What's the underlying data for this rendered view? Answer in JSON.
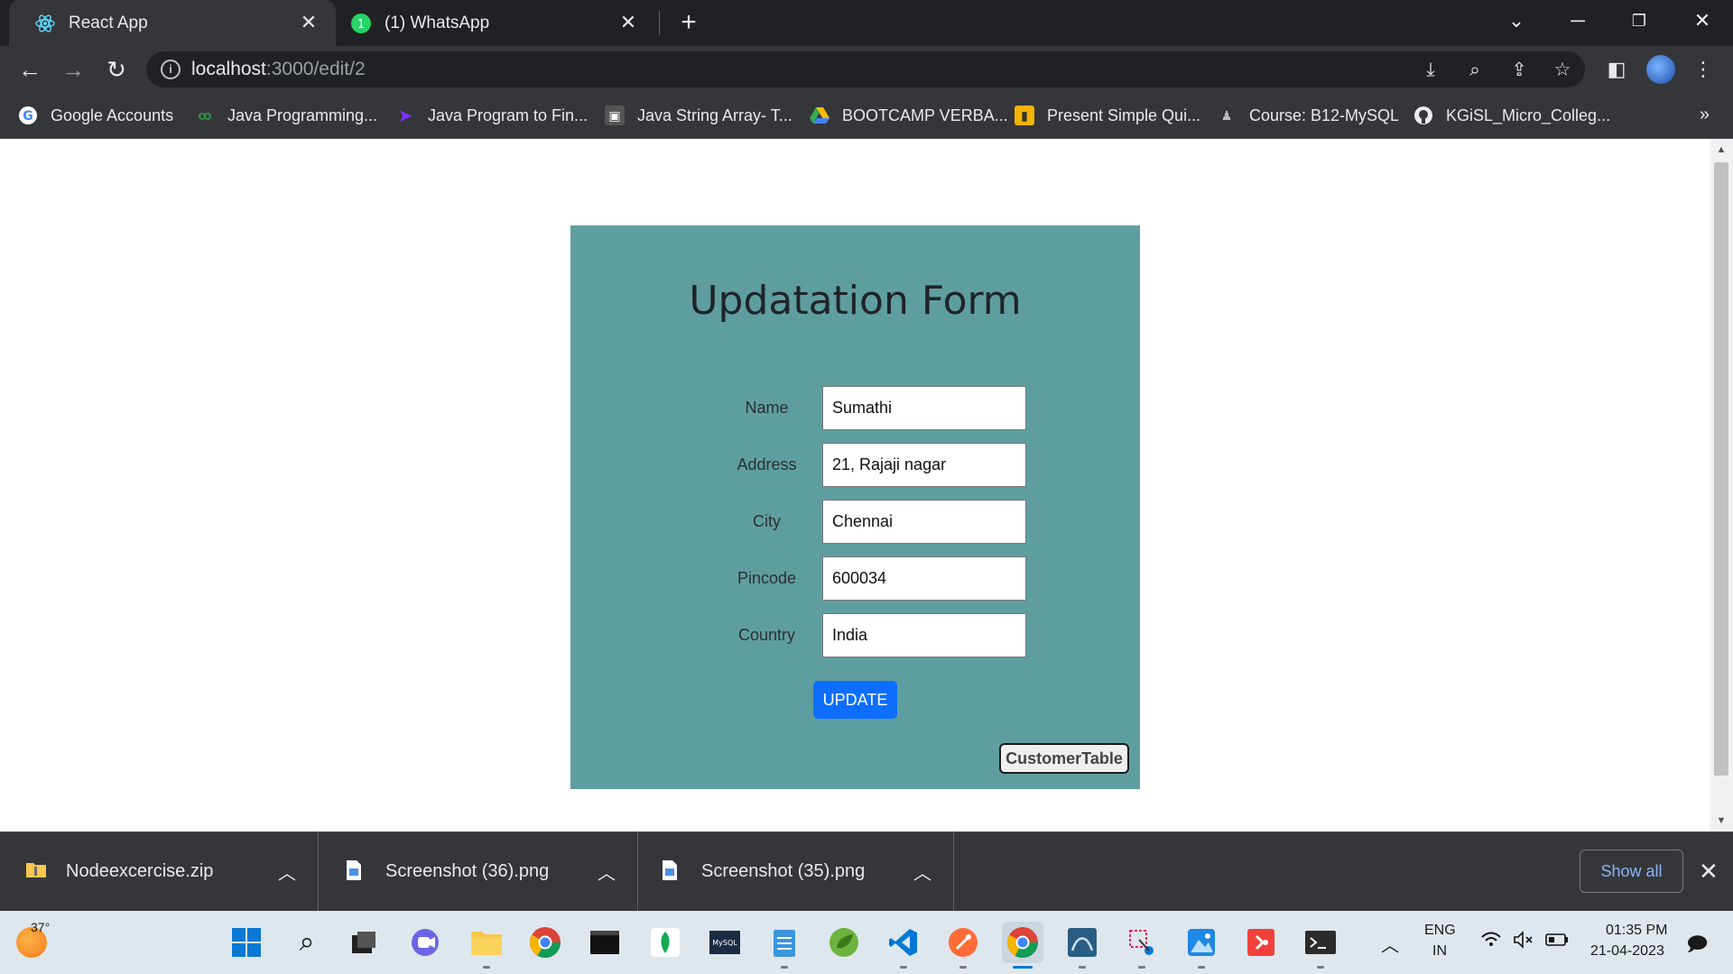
{
  "browser": {
    "tabs": [
      {
        "title": "React App",
        "active": true,
        "icon": "react-icon"
      },
      {
        "title": "(1) WhatsApp",
        "active": false,
        "icon": "whatsapp-icon"
      }
    ],
    "url_host": "localhost",
    "url_path": ":3000/edit/2",
    "bookmarks": [
      {
        "label": "Google Accounts",
        "icon": "google-icon",
        "color": "#4285f4"
      },
      {
        "label": "Java Programming...",
        "icon": "gfg-icon",
        "color": "#2f8d46"
      },
      {
        "label": "Java Program to Fin...",
        "icon": "bookmark-icon",
        "color": "#7b2ff7"
      },
      {
        "label": "Java String Array- T...",
        "icon": "bookmark-icon",
        "color": "#555555"
      },
      {
        "label": "BOOTCAMP VERBA...",
        "icon": "drive-icon",
        "color": "#fbbc04"
      },
      {
        "label": "Present Simple Qui...",
        "icon": "bookmark-icon",
        "color": "#f4b400"
      },
      {
        "label": "Course: B12-MySQL",
        "icon": "bookmark-icon",
        "color": "#9e9e9e"
      },
      {
        "label": "KGiSL_Micro_Colleg...",
        "icon": "github-icon",
        "color": "#e8eaed"
      }
    ]
  },
  "form": {
    "title": "Updatation Form",
    "fields": [
      {
        "label": "Name",
        "value": "Sumathi"
      },
      {
        "label": "Address",
        "value": "21, Rajaji nagar"
      },
      {
        "label": "City",
        "value": "Chennai"
      },
      {
        "label": "Pincode",
        "value": "600034"
      },
      {
        "label": "Country",
        "value": "India"
      }
    ],
    "update_label": "UPDATE",
    "customer_table_label": "CustomerTable",
    "background": "#5f9ea0",
    "button_color": "#0d6efd"
  },
  "downloads": {
    "items": [
      {
        "name": "Nodeexcercise.zip",
        "icon": "zip-folder-icon"
      },
      {
        "name": "Screenshot (36).png",
        "icon": "image-file-icon"
      },
      {
        "name": "Screenshot (35).png",
        "icon": "image-file-icon"
      }
    ],
    "show_all_label": "Show all"
  },
  "taskbar": {
    "weather_temp": "37°",
    "lang_top": "ENG",
    "lang_bottom": "IN",
    "time": "01:35 PM",
    "date": "21-04-2023"
  }
}
